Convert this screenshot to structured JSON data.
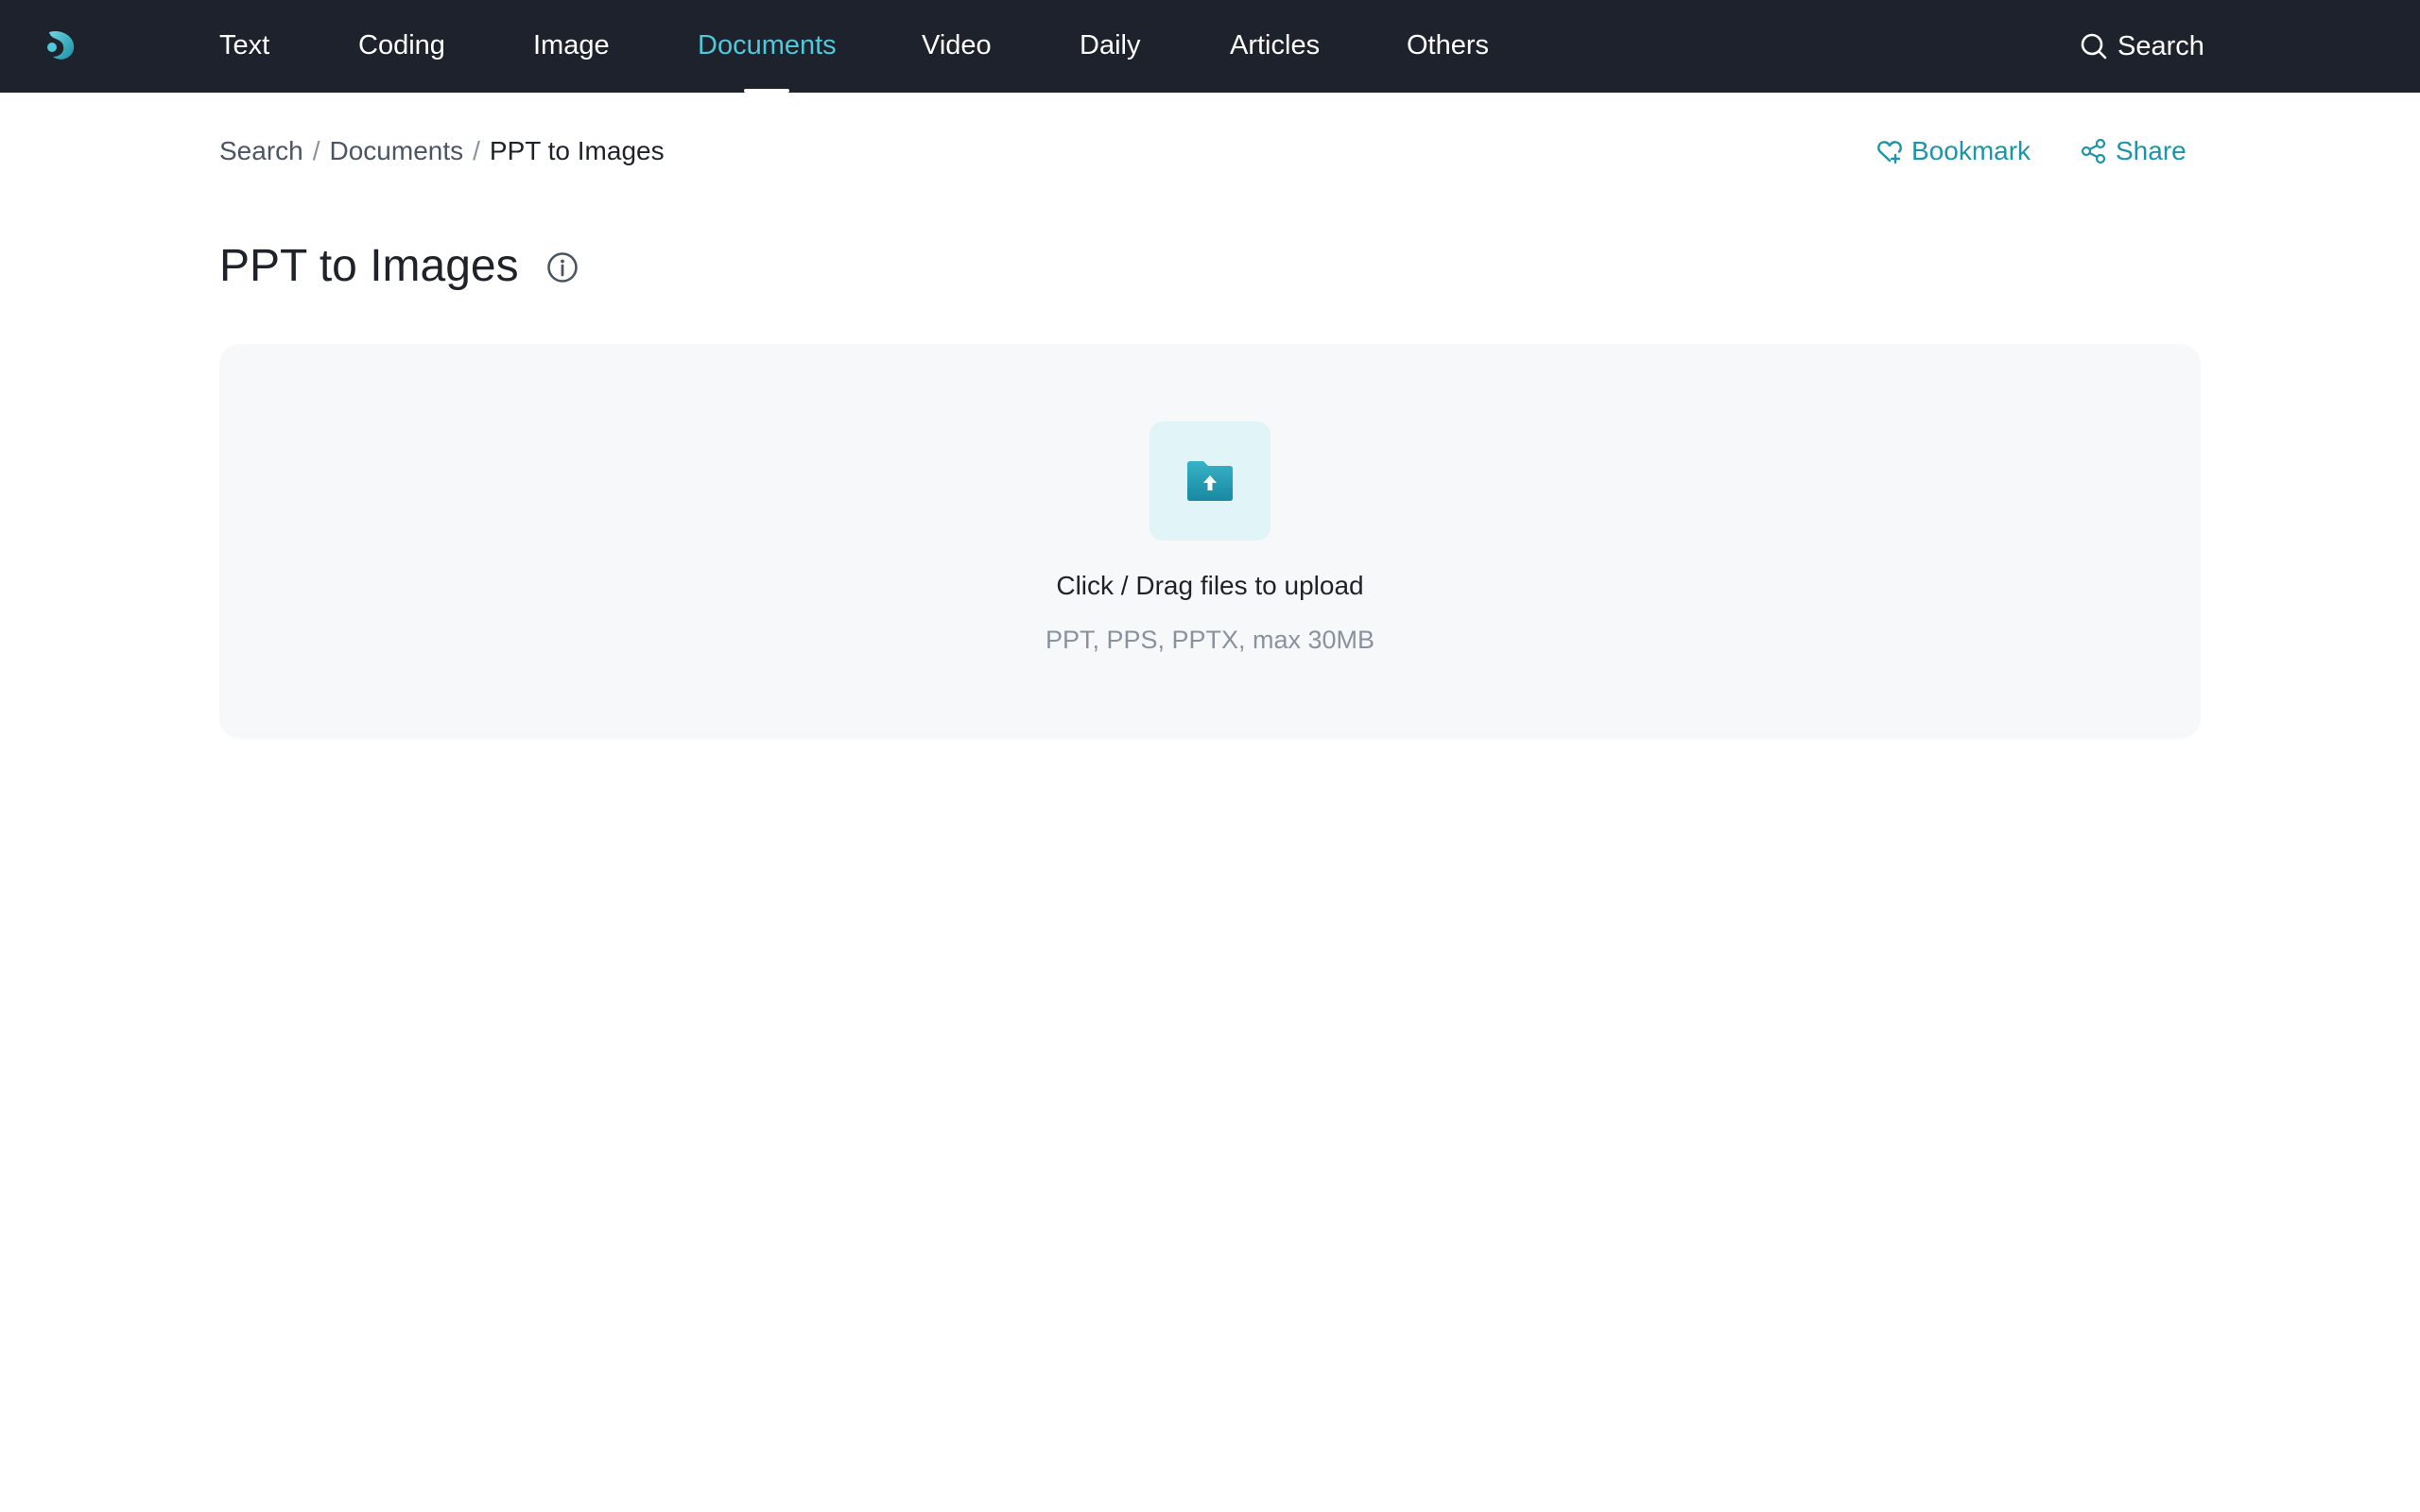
{
  "nav": {
    "items": [
      {
        "label": "Text"
      },
      {
        "label": "Coding"
      },
      {
        "label": "Image"
      },
      {
        "label": "Documents",
        "active": true
      },
      {
        "label": "Video"
      },
      {
        "label": "Daily"
      },
      {
        "label": "Articles"
      },
      {
        "label": "Others"
      }
    ],
    "search_label": "Search"
  },
  "breadcrumb": {
    "items": [
      "Search",
      "Documents"
    ],
    "separator": "/",
    "current": "PPT to Images"
  },
  "actions": {
    "bookmark_label": "Bookmark",
    "share_label": "Share"
  },
  "page": {
    "title": "PPT to Images"
  },
  "upload": {
    "title": "Click / Drag files to upload",
    "subtitle": "PPT, PPS, PPTX, max 30MB"
  },
  "icons": {
    "logo": "logo-icon",
    "search": "search-icon",
    "bookmark": "bookmark-icon",
    "share": "share-icon",
    "info": "info-icon",
    "upload": "folder-upload-icon"
  },
  "colors": {
    "topbar_bg": "#1d222c",
    "nav_active": "#4fc8d9",
    "accent": "#1c95a9",
    "upload_bg": "#f7f8fa",
    "upload_icon_bg": "#e1f4f7"
  }
}
